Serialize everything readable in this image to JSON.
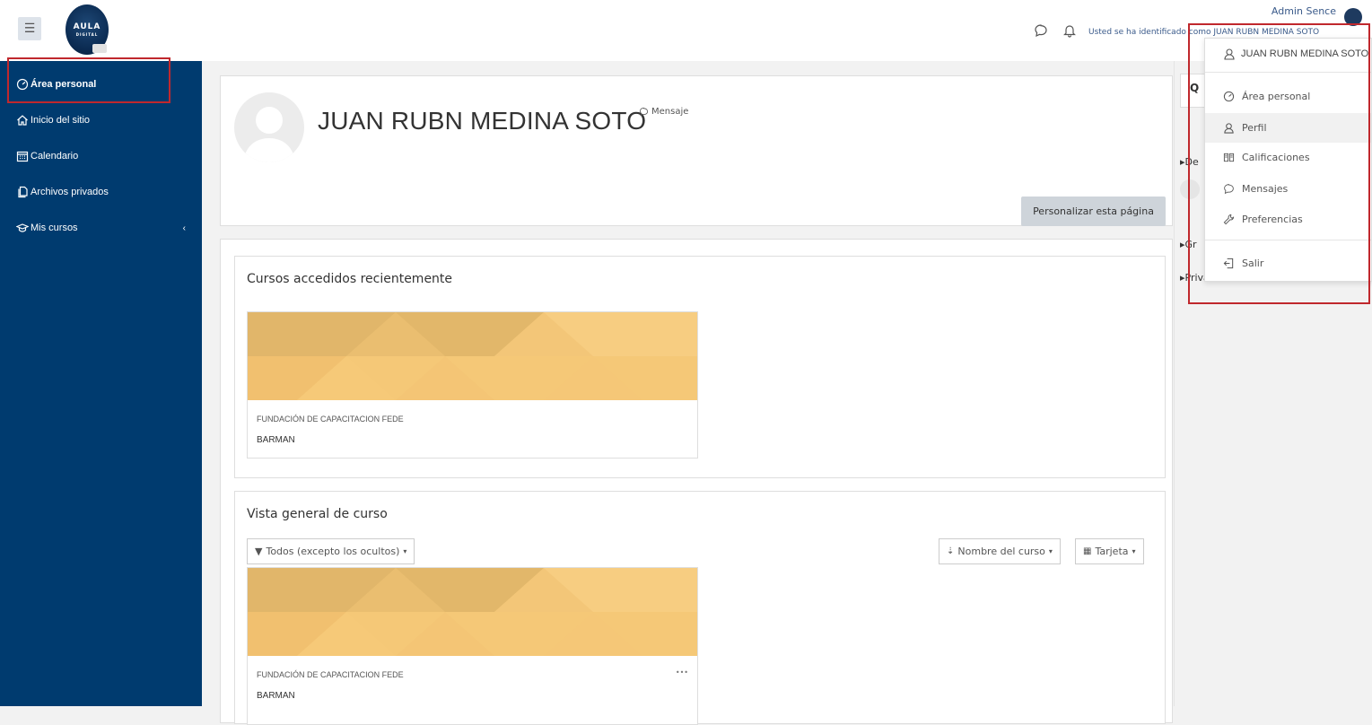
{
  "topbar": {
    "logo_text": "AULA",
    "logo_sub": "DIGITAL",
    "logged_in_text": "Usted se ha identificado como  JUAN RUBN MEDINA SOTO",
    "admin_name": "Admin Sence"
  },
  "sidebar": {
    "items": [
      {
        "label": "Área personal",
        "icon": "dashboard-icon"
      },
      {
        "label": "Inicio del sitio",
        "icon": "home-icon"
      },
      {
        "label": "Calendario",
        "icon": "calendar-icon"
      },
      {
        "label": "Archivos privados",
        "icon": "files-icon"
      },
      {
        "label": "Mis cursos",
        "icon": "graduation-cap-icon"
      }
    ],
    "caret": "‹"
  },
  "profile": {
    "name": "JUAN RUBN MEDINA SOTO",
    "message_link": "Mensaje",
    "customize_button": "Personalizar esta página"
  },
  "recent_courses": {
    "title": "Cursos accedidos recientemente",
    "course": {
      "category": "FUNDACIÓN DE CAPACITACION FEDE",
      "name": "BARMAN"
    }
  },
  "overview": {
    "title": "Vista general de curso",
    "filter": "Todos (excepto los ocultos)",
    "sort": "Nombre del curso",
    "view": "Tarjeta",
    "course": {
      "category": "FUNDACIÓN DE CAPACITACION FEDE",
      "name": "BARMAN",
      "menu": "•••"
    }
  },
  "right_column": {
    "search_icon": "Q",
    "items": [
      "De",
      "Gr",
      "Privado"
    ]
  },
  "user_menu": {
    "header": "JUAN RUBN MEDINA SOTO",
    "items": [
      {
        "label": "Área personal",
        "icon": "dashboard-icon"
      },
      {
        "label": "Perfil",
        "icon": "user-icon"
      },
      {
        "label": "Calificaciones",
        "icon": "grades-icon"
      },
      {
        "label": "Mensajes",
        "icon": "chat-icon"
      },
      {
        "label": "Preferencias",
        "icon": "wrench-icon"
      },
      {
        "label": "Salir",
        "icon": "logout-icon"
      }
    ]
  },
  "colors": {
    "sidebar": "#003b6f",
    "highlight_border": "#c0282d",
    "course_banner": "#f5c877"
  }
}
